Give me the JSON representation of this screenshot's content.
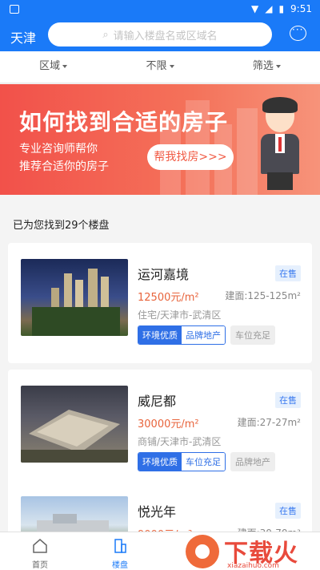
{
  "status_bar": {
    "time": "9:51"
  },
  "header": {
    "city": "天津",
    "search_placeholder": "请输入楼盘名或区域名"
  },
  "filters": [
    {
      "label": "区域"
    },
    {
      "label": "不限"
    },
    {
      "label": "筛选"
    }
  ],
  "banner": {
    "title": "如何找到合适的房子",
    "subtitle_line1": "专业咨询师帮你",
    "subtitle_line2": "推荐合适你的房子",
    "button": "帮我找房>>>"
  },
  "result_count_text": "已为您找到29个楼盘",
  "listings": [
    {
      "name": "运河嘉境",
      "status": "在售",
      "price": "12500元/m²",
      "area": "建面:125-125m²",
      "address": "住宅/天津市-武清区",
      "tags_primary": [
        "环境优质",
        "品牌地产"
      ],
      "tags_secondary": [
        "车位充足"
      ]
    },
    {
      "name": "威尼都",
      "status": "在售",
      "price": "30000元/m²",
      "area": "建面:27-27m²",
      "address": "商铺/天津市-武清区",
      "tags_primary": [
        "环境优质",
        "车位充足"
      ],
      "tags_secondary": [
        "品牌地产"
      ]
    },
    {
      "name": "悦光年",
      "status": "在售",
      "price": "9000元/m²",
      "area": "建面:30-70m²"
    }
  ],
  "tabbar": [
    {
      "label": "首页"
    },
    {
      "label": "楼盘"
    }
  ],
  "watermark": {
    "text": "下载火",
    "sub": "xiazaihuo.com"
  },
  "colors": {
    "primary": "#1a7af8",
    "price": "#e8643c",
    "banner": "#f2514a"
  }
}
